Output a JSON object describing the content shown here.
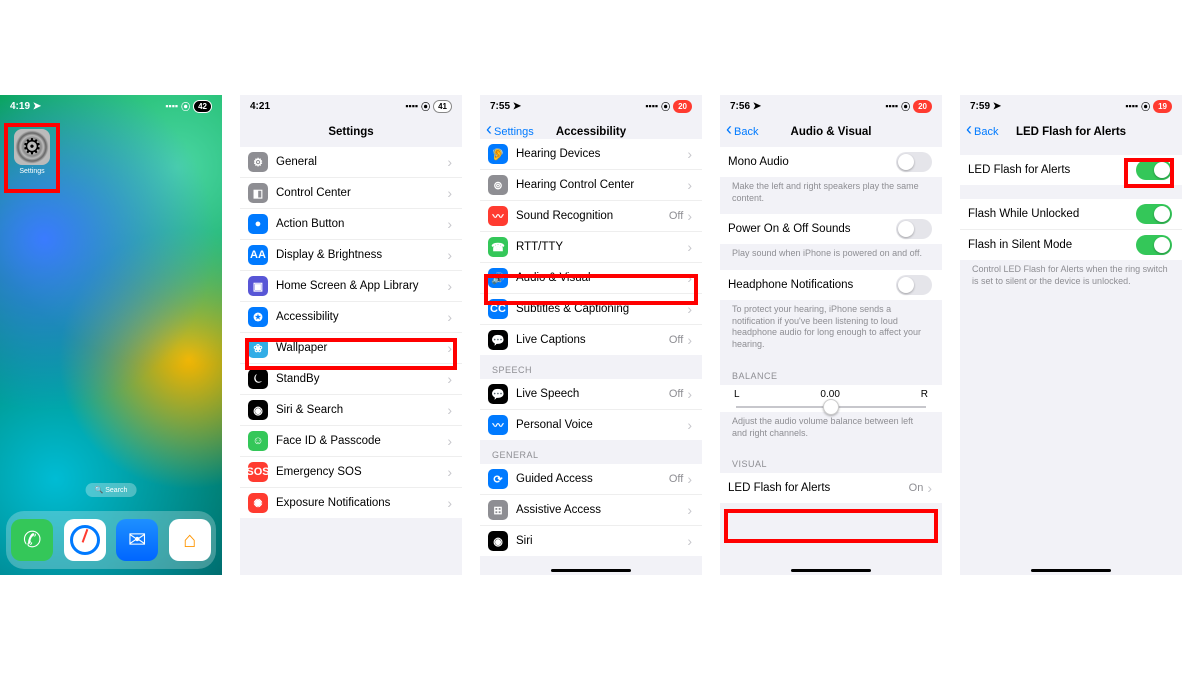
{
  "phone1": {
    "time": "4:19",
    "location_arrow": "➤",
    "app_label": "Settings",
    "search": "🔍 Search",
    "batt": "42"
  },
  "phone2": {
    "time": "4:21",
    "title": "Settings",
    "batt": "41",
    "rows": [
      {
        "icon": "⚙",
        "bg": "bg-gray",
        "label": "General"
      },
      {
        "icon": "◧",
        "bg": "bg-gray",
        "label": "Control Center"
      },
      {
        "icon": "●",
        "bg": "bg-blue",
        "label": "Action Button"
      },
      {
        "icon": "AA",
        "bg": "bg-blue",
        "label": "Display & Brightness"
      },
      {
        "icon": "▣",
        "bg": "bg-purple",
        "label": "Home Screen & App Library"
      },
      {
        "icon": "✪",
        "bg": "bg-blue",
        "label": "Accessibility"
      },
      {
        "icon": "❀",
        "bg": "bg-cyan",
        "label": "Wallpaper"
      },
      {
        "icon": "⏾",
        "bg": "bg-dark",
        "label": "StandBy"
      },
      {
        "icon": "◉",
        "bg": "bg-dark",
        "label": "Siri & Search"
      },
      {
        "icon": "☺",
        "bg": "bg-green",
        "label": "Face ID & Passcode"
      },
      {
        "icon": "SOS",
        "bg": "bg-red",
        "label": "Emergency SOS"
      },
      {
        "icon": "✺",
        "bg": "bg-red",
        "label": "Exposure Notifications"
      }
    ]
  },
  "phone3": {
    "time": "7:55",
    "back": "Settings",
    "title": "Accessibility",
    "batt": "20",
    "rows1": [
      {
        "icon": "🦻",
        "bg": "bg-blue",
        "label": "Hearing Devices",
        "val": ""
      },
      {
        "icon": "⊚",
        "bg": "bg-gray",
        "label": "Hearing Control Center",
        "val": ""
      },
      {
        "icon": "〰",
        "bg": "bg-red",
        "label": "Sound Recognition",
        "val": "Off"
      },
      {
        "icon": "☎",
        "bg": "bg-green",
        "label": "RTT/TTY",
        "val": ""
      },
      {
        "icon": "🔊",
        "bg": "bg-blue",
        "label": "Audio & Visual",
        "val": ""
      },
      {
        "icon": "CC",
        "bg": "bg-blue",
        "label": "Subtitles & Captioning",
        "val": ""
      },
      {
        "icon": "💬",
        "bg": "bg-dark",
        "label": "Live Captions",
        "val": "Off"
      }
    ],
    "section_speech": "SPEECH",
    "rows2": [
      {
        "icon": "💬",
        "bg": "bg-dark",
        "label": "Live Speech",
        "val": "Off"
      },
      {
        "icon": "〰",
        "bg": "bg-blue",
        "label": "Personal Voice",
        "val": ""
      }
    ],
    "section_general": "GENERAL",
    "rows3": [
      {
        "icon": "⟳",
        "bg": "bg-blue",
        "label": "Guided Access",
        "val": "Off"
      },
      {
        "icon": "⊞",
        "bg": "bg-gray",
        "label": "Assistive Access",
        "val": ""
      },
      {
        "icon": "◉",
        "bg": "bg-dark",
        "label": "Siri",
        "val": ""
      }
    ]
  },
  "phone4": {
    "time": "7:56",
    "back": "Back",
    "title": "Audio & Visual",
    "batt": "20",
    "row_mono": "Mono Audio",
    "foot_mono": "Make the left and right speakers play the same content.",
    "row_power": "Power On & Off Sounds",
    "foot_power": "Play sound when iPhone is powered on and off.",
    "row_headphone": "Headphone Notifications",
    "foot_headphone": "To protect your hearing, iPhone sends a notification if you've been listening to loud headphone audio for long enough to affect your hearing.",
    "section_balance": "BALANCE",
    "balance_L": "L",
    "balance_C": "0.00",
    "balance_R": "R",
    "foot_balance": "Adjust the audio volume balance between left and right channels.",
    "section_visual": "VISUAL",
    "row_led": "LED Flash for Alerts",
    "row_led_val": "On"
  },
  "phone5": {
    "time": "7:59",
    "back": "Back",
    "title": "LED Flash for Alerts",
    "batt": "19",
    "row_main": "LED Flash for Alerts",
    "row_unlocked": "Flash While Unlocked",
    "row_silent": "Flash in Silent Mode",
    "foot": "Control LED Flash for Alerts when the ring switch is set to silent or the device is unlocked."
  }
}
